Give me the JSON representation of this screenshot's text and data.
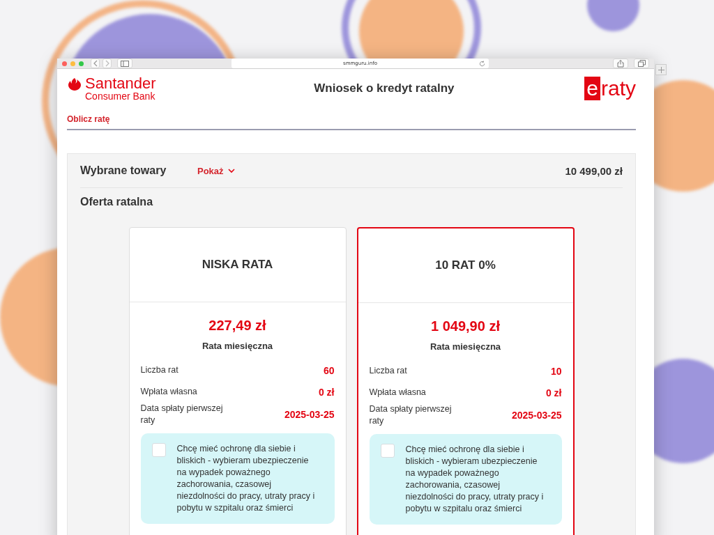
{
  "browser": {
    "url": "smmguru.info"
  },
  "header": {
    "brand": "Santander",
    "brand_sub": "Consumer Bank",
    "title": "Wniosek o kredyt ratalny",
    "logo_badge": "e",
    "logo_text": "raty"
  },
  "tabs": [
    {
      "label": "Oblicz ratę",
      "selected": true
    }
  ],
  "summary": {
    "label": "Wybrane towary",
    "toggle": "Pokaż",
    "total": "10 499,00 zł"
  },
  "offer_heading": "Oferta ratalna",
  "offers": [
    {
      "name": "NISKA RATA",
      "selected": false,
      "amount": "227,49 zł",
      "amount_label": "Rata miesięczna",
      "rows": [
        {
          "label": "Liczba rat",
          "value": "60"
        },
        {
          "label": "Wpłata własna",
          "value": "0 zł"
        },
        {
          "label": "Data spłaty pierwszej raty",
          "value": "2025-03-25"
        }
      ],
      "insurance": {
        "checked": false,
        "text": "Chcę mieć ochronę dla siebie i bliskich - wybieram ubezpieczenie na wypadek poważnego zachorowania, czasowej niezdolności do pracy, utraty pracy i pobytu w szpitalu oraz śmierci"
      }
    },
    {
      "name": "10 RAT 0%",
      "selected": true,
      "amount": "1 049,90 zł",
      "amount_label": "Rata miesięczna",
      "rows": [
        {
          "label": "Liczba rat",
          "value": "10"
        },
        {
          "label": "Wpłata własna",
          "value": "0 zł"
        },
        {
          "label": "Data spłaty pierwszej raty",
          "value": "2025-03-25"
        }
      ],
      "insurance": {
        "checked": false,
        "text": "Chcę mieć ochronę dla siebie i bliskich - wybieram ubezpieczenie na wypadek poważnego zachorowania, czasowej niezdolności do pracy, utraty pracy i pobytu w szpitalu oraz śmierci"
      }
    }
  ]
}
